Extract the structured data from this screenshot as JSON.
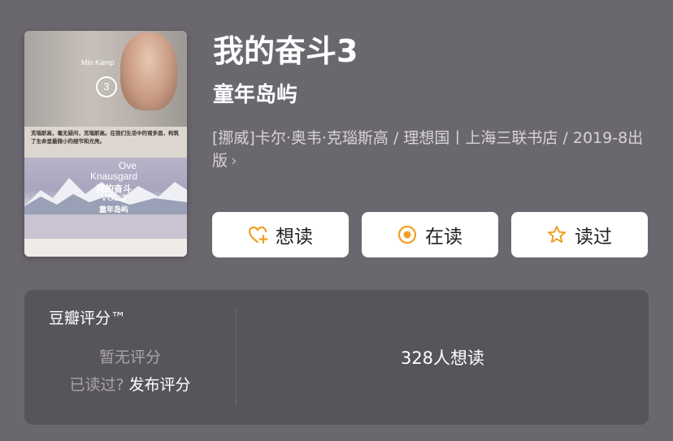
{
  "book": {
    "title": "我的奋斗3",
    "subtitle": "童年岛屿",
    "meta": "[挪威]卡尔·奥韦·克瑙斯高 / 理想国丨上海三联书店 / 2019-8出版",
    "meta_chevron": "›"
  },
  "cover": {
    "series": "Min Kamp",
    "number": "3",
    "blurb": "克瑙斯高，毫无疑问，克瑙斯高。在我们生活中的诸多面，构筑了生命里最微小的细节和光亮。",
    "author_first": "Ove",
    "author_last": "Knausgard",
    "title": "我的奋斗",
    "volume": "VOL.3",
    "subtitle": "童年岛屿"
  },
  "actions": [
    {
      "label": "想读",
      "icon": "heart-plus-icon",
      "color": "#f0a020"
    },
    {
      "label": "在读",
      "icon": "target-circle-icon",
      "color": "#f0a020"
    },
    {
      "label": "读过",
      "icon": "star-outline-icon",
      "color": "#f0a020"
    }
  ],
  "rating": {
    "title": "豆瓣评分™",
    "no_rating": "暂无评分",
    "read_prompt": "已读过?",
    "post_rating": "发布评分",
    "want_count": "328人想读"
  }
}
